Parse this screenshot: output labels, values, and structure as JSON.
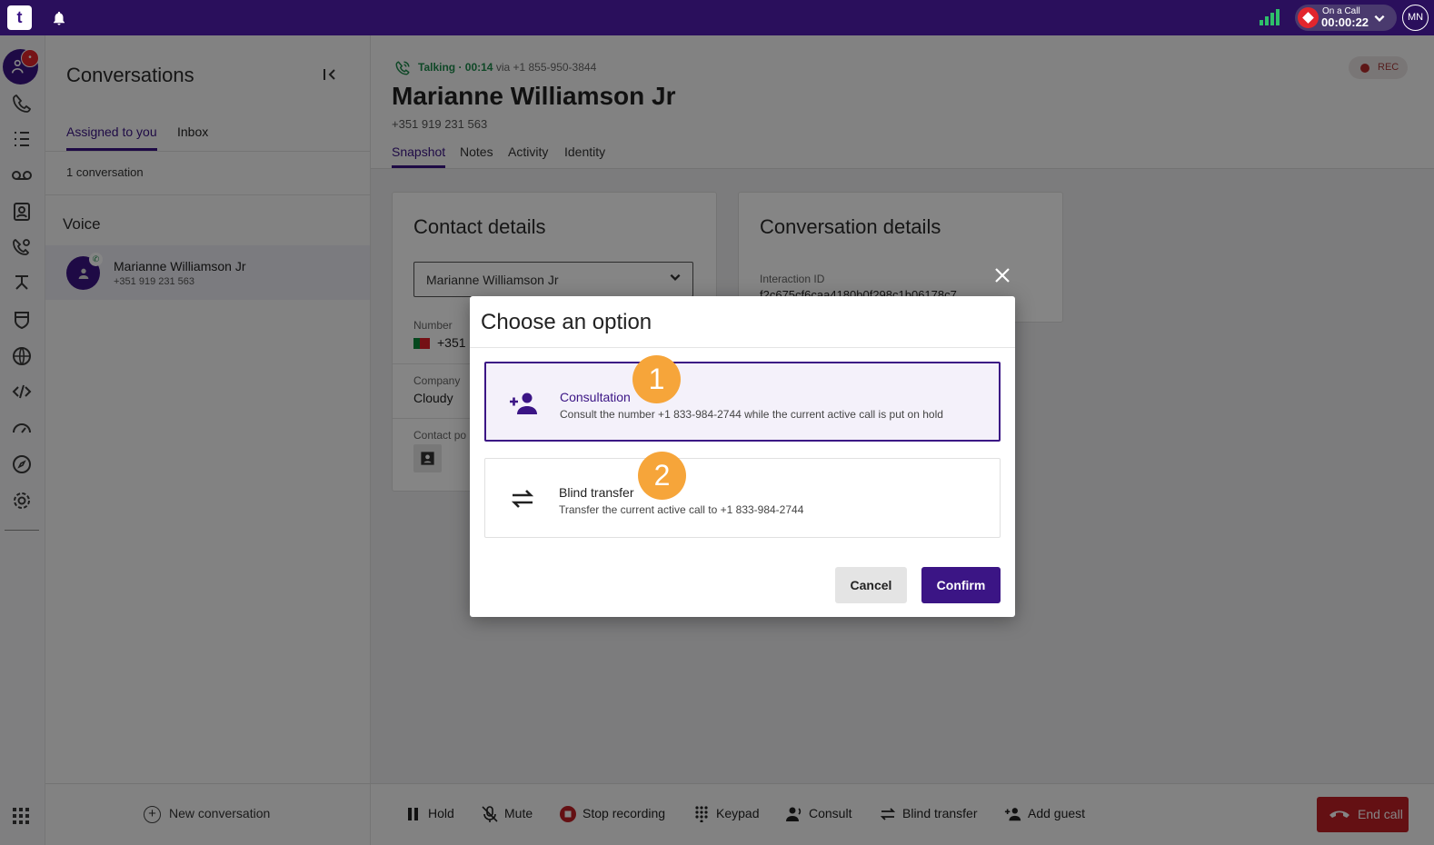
{
  "topbar": {
    "logo": "t",
    "on_call_label": "On a Call",
    "on_call_time": "00:00:22",
    "user_initials": "MN"
  },
  "rail": {
    "badge": "•",
    "icons": [
      "agent-icon",
      "call-log-icon",
      "queues-icon",
      "voicemail-icon",
      "contacts-icon",
      "call-settings-icon",
      "flows-icon",
      "security-icon",
      "globe-icon",
      "code-icon",
      "dashboard-icon",
      "explore-icon",
      "settings-icon",
      "apps-grid-icon"
    ]
  },
  "conversations": {
    "title": "Conversations",
    "tabs": [
      {
        "label": "Assigned to you"
      },
      {
        "label": "Inbox"
      }
    ],
    "count": "1 conversation",
    "section": "Voice",
    "items": [
      {
        "name": "Marianne Williamson Jr",
        "number": "+351 919 231 563"
      }
    ],
    "new_label": "New conversation"
  },
  "main": {
    "status_talking": "Talking · 00:14",
    "status_via": " via +1 855-950-3844",
    "contact_name": "Marianne Williamson Jr",
    "contact_number": "+351 919 231 563",
    "rec_label": "REC",
    "tabs": [
      {
        "label": "Snapshot"
      },
      {
        "label": "Notes"
      },
      {
        "label": "Activity"
      },
      {
        "label": "Identity"
      }
    ],
    "contact_details": {
      "title": "Contact details",
      "selected": "Marianne Williamson Jr",
      "number_label": "Number",
      "number_value": "+351",
      "company_label": "Company",
      "company_value": "Cloudy",
      "contact_po_label": "Contact po"
    },
    "conversation_details": {
      "title": "Conversation details",
      "interaction_label": "Interaction ID",
      "interaction_value": "f2c675cf6caa4180b0f298c1b06178c7"
    }
  },
  "actions": {
    "hold": "Hold",
    "mute": "Mute",
    "stop_recording": "Stop recording",
    "keypad": "Keypad",
    "consult": "Consult",
    "blind_transfer": "Blind transfer",
    "add_guest": "Add guest",
    "end_call": "End call"
  },
  "modal": {
    "title": "Choose an option",
    "options": [
      {
        "title": "Consultation",
        "description": "Consult the number +1 833-984-2744 while the current active call is put on hold",
        "step": "1"
      },
      {
        "title": "Blind transfer",
        "description": "Transfer the current active call to +1 833-984-2744",
        "step": "2"
      }
    ],
    "cancel": "Cancel",
    "confirm": "Confirm"
  },
  "colors": {
    "brand": "#3b1585",
    "topbar": "#2a0f5c",
    "alert": "#e2262d",
    "talking": "#1e8a4c",
    "step": "#f6a53a"
  }
}
